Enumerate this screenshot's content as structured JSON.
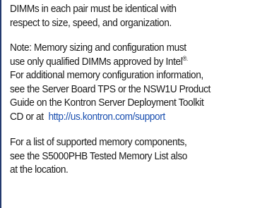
{
  "doc": {
    "para1": {
      "lines": [
        "DIMMs in each pair must be identical with",
        "respect to size, speed, and organization."
      ]
    },
    "para2": {
      "lines": [
        "Note:  Memory sizing and configuration must",
        "use only qualified DIMMs approved by Intel",
        "For additional memory configuration information,",
        "see the Server Board TPS or the NSW1U Product",
        "Guide on the Kontron Server Deployment Toolkit",
        "CD or at"
      ],
      "registered_mark": "®.",
      "link_text": "http://us.kontron.com/support"
    },
    "para3": {
      "lines": [
        "For a list of supported memory components,",
        "see the S5000PHB Tested Memory List also",
        "at the location."
      ]
    }
  }
}
